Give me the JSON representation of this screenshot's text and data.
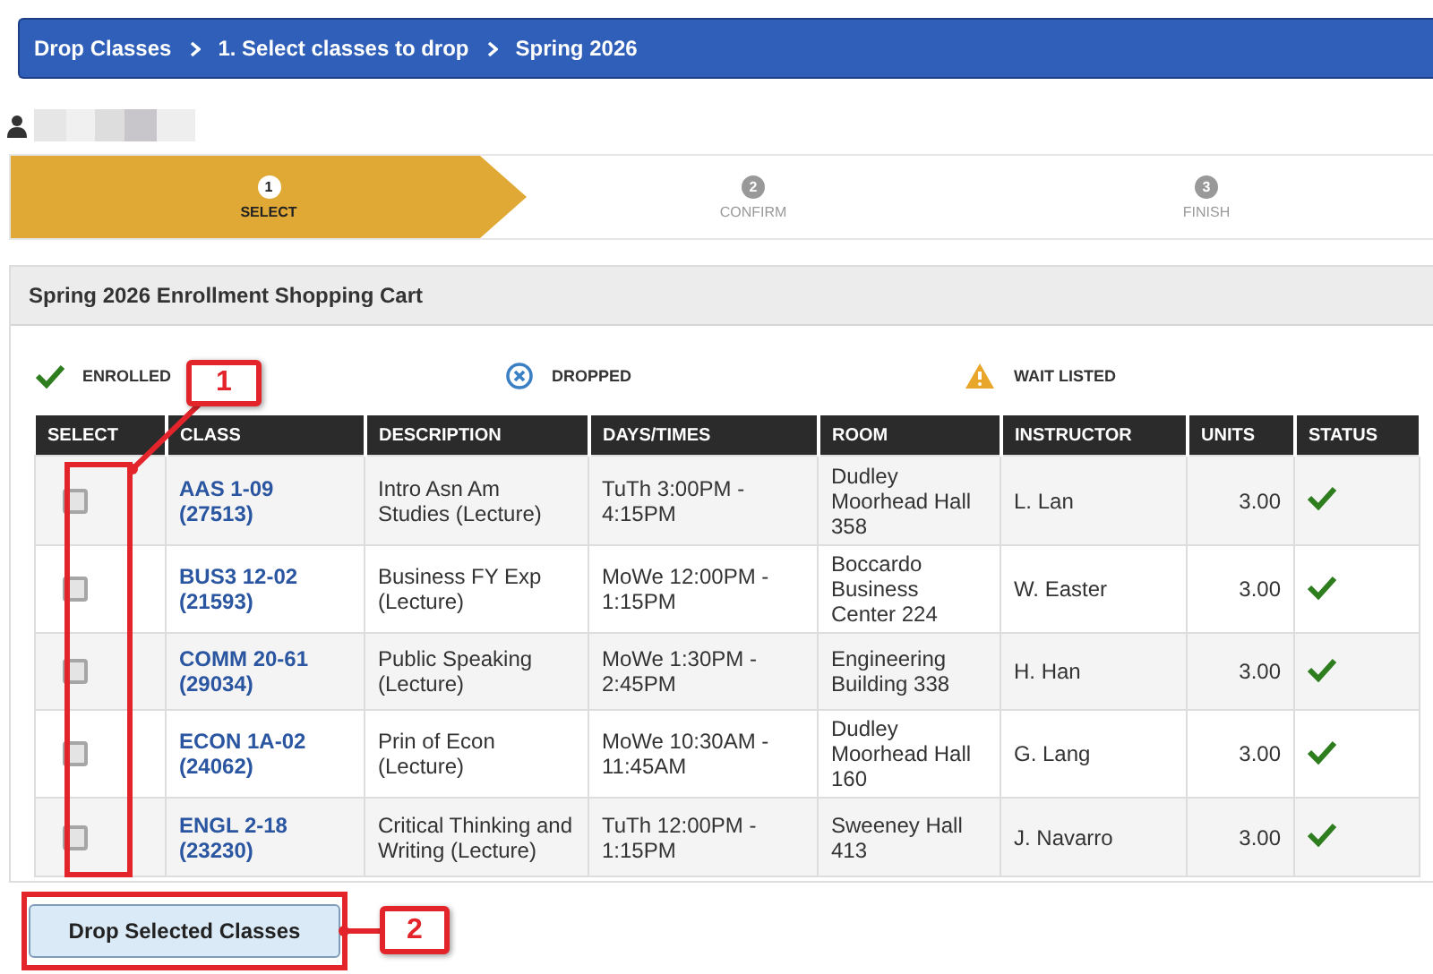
{
  "breadcrumb": [
    "Drop Classes",
    "1.  Select classes to drop",
    "Spring 2026"
  ],
  "steps": [
    {
      "number": "1",
      "label": "SELECT",
      "selected": true
    },
    {
      "number": "2",
      "label": "CONFIRM",
      "selected": false
    },
    {
      "number": "3",
      "label": "FINISH",
      "selected": false
    }
  ],
  "cart": {
    "title": "Spring 2026 Enrollment Shopping Cart",
    "legend": [
      {
        "kind": "enrolled",
        "label": "ENROLLED"
      },
      {
        "kind": "dropped",
        "label": "DROPPED"
      },
      {
        "kind": "waitlisted",
        "label": "WAIT LISTED"
      }
    ],
    "columns": [
      "SELECT",
      "CLASS",
      "DESCRIPTION",
      "DAYS/TIMES",
      "ROOM",
      "INSTRUCTOR",
      "UNITS",
      "STATUS"
    ],
    "rows": [
      {
        "checked": false,
        "class": "AAS 1-09",
        "number": "(27513)",
        "description": "Intro Asn Am Studies (Lecture)",
        "days_times": "TuTh 3:00PM - 4:15PM",
        "room": "Dudley Moorhead Hall 358",
        "instructor": "L. Lan",
        "units": "3.00",
        "kind": "enrolled"
      },
      {
        "checked": false,
        "class": "BUS3 12-02",
        "number": "(21593)",
        "description": "Business FY Exp (Lecture)",
        "days_times": "MoWe 12:00PM - 1:15PM",
        "room": "Boccardo Business Center 224",
        "instructor": "W. Easter",
        "units": "3.00",
        "kind": "enrolled"
      },
      {
        "checked": false,
        "class": "COMM 20-61",
        "number": "(29034)",
        "description": "Public Speaking (Lecture)",
        "days_times": "MoWe 1:30PM - 2:45PM",
        "room": "Engineering Building 338",
        "instructor": "H. Han",
        "units": "3.00",
        "kind": "enrolled"
      },
      {
        "checked": false,
        "class": "ECON 1A-02",
        "number": "(24062)",
        "description": "Prin of Econ (Lecture)",
        "days_times": "MoWe 10:30AM - 11:45AM",
        "room": "Dudley Moorhead Hall 160",
        "instructor": "G. Lang",
        "units": "3.00",
        "kind": "enrolled"
      },
      {
        "checked": false,
        "class": "ENGL 2-18",
        "number": "(23230)",
        "description": "Critical Thinking and Writing (Lecture)",
        "days_times": "TuTh 12:00PM - 1:15PM",
        "room": "Sweeney Hall 413",
        "instructor": "J. Navarro",
        "units": "3.00",
        "kind": "enrolled"
      }
    ]
  },
  "drop_button": "Drop Selected Classes",
  "annotations": [
    "1",
    "2"
  ]
}
